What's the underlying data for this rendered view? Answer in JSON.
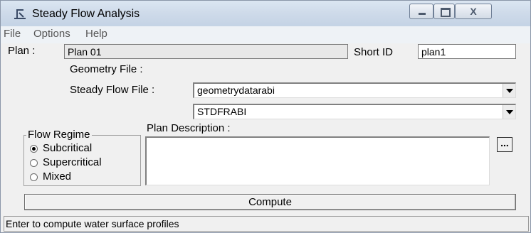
{
  "window": {
    "title": "Steady Flow Analysis",
    "close_glyph": "X"
  },
  "menu": [
    "File",
    "Options",
    "Help"
  ],
  "plan": {
    "label": "Plan :",
    "value": "Plan 01",
    "short_id_label": "Short ID",
    "short_id_value": "plan1"
  },
  "geometry": {
    "label": "Geometry File :",
    "value": "geometrydatarabi"
  },
  "steady_flow": {
    "label": "Steady Flow File :",
    "value": "STDFRABI"
  },
  "flow_regime": {
    "legend": "Flow Regime",
    "options": [
      "Subcritical",
      "Supercritical",
      "Mixed"
    ],
    "selected": "Subcritical"
  },
  "plan_description": {
    "label": "Plan Description :",
    "value": "",
    "button": "..."
  },
  "compute_label": "Compute",
  "status": "Enter to compute water surface profiles"
}
